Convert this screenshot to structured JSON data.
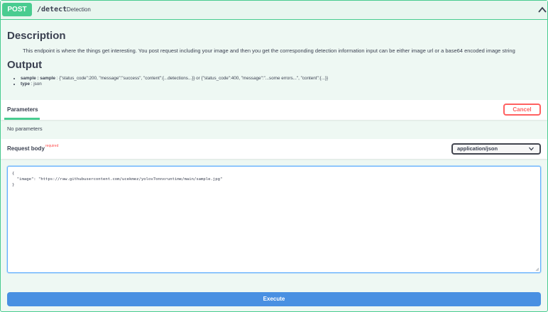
{
  "summary": {
    "method": "POST",
    "path": "/detect",
    "description": "Detection",
    "collapse_icon": "chevron-up-icon"
  },
  "description": {
    "heading": "Description",
    "text": "This endpoint is where the things get interesting. You post request including your image and then you get the corresponding detection information input can be either image url or a base64 encoded image string"
  },
  "output": {
    "heading": "Output",
    "items": [
      {
        "key": "sample : sample",
        "value": " : {\"status_code\":200, \"message\":\"success\", \"content\":{...detections...}} or {\"status_code\":400, \"message\":\"...some errors...\", \"content\":{...}}"
      },
      {
        "key": "type",
        "value": " : json"
      }
    ]
  },
  "parameters": {
    "tab_label": "Parameters",
    "cancel_label": "Cancel",
    "empty_text": "No parameters"
  },
  "request_body": {
    "label": "Request body",
    "required_label": "required",
    "content_type": "application/json",
    "select_icon": "chevron-down-icon",
    "editor_value": "{\n  \"image\": \"https://raw.githubusercontent.com/ucekmez/yolov7onnxruntime/main/sample.jpg\"\n}"
  },
  "actions": {
    "execute_label": "Execute"
  },
  "colors": {
    "post_green": "#49cc90",
    "cancel_red": "#ff6060",
    "execute_blue": "#4990e2"
  }
}
